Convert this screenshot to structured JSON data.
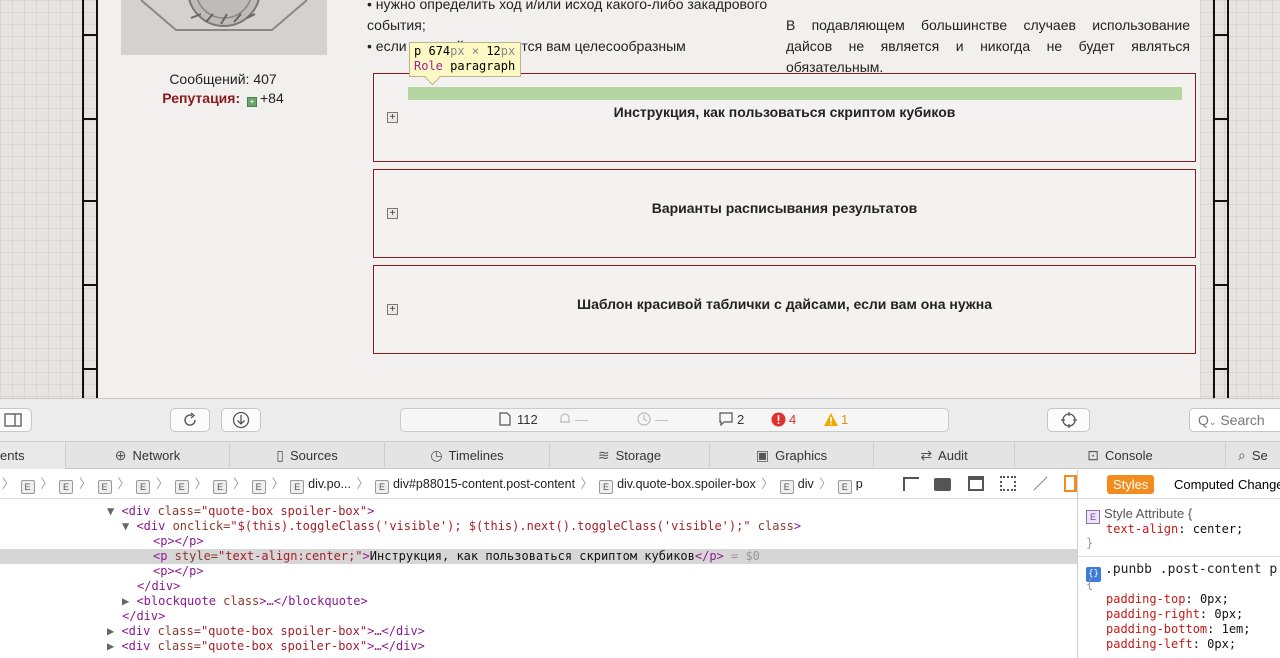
{
  "page": {
    "posts_label": "Сообщений: 407",
    "rep_label": "Репутация:",
    "rep_value": "+84",
    "left_lines": [
      "• нужно определить ход и/или исход какого-либо закадрового",
      "события;",
      "• если"
    ],
    "left_line3_tail": "айсов кажется вам целесообразным",
    "right_text": "В подавляющем большинстве случаев использование дайсов не является и никогда не будет являться обязательным.",
    "spoilers": [
      {
        "title": "Инструкция, как пользоваться скриптом кубиков",
        "toggle": "+"
      },
      {
        "title": "Варианты расписывания результатов",
        "toggle": "+"
      },
      {
        "title": "Шаблон красивой таблички с дайсами, если вам она нужна",
        "toggle": "+"
      }
    ],
    "tooltip": {
      "tag": "p",
      "width": "674",
      "height": "12",
      "unit": "px",
      "times": "×",
      "role_label": "Role",
      "role_value": "paragraph"
    }
  },
  "devtools": {
    "activity": {
      "resources": "112",
      "dash1": "—",
      "dash2": "—",
      "logs": "2",
      "errors": "4",
      "warnings": "1"
    },
    "search_placeholder": "Search",
    "tabs": [
      {
        "label": "ents",
        "icon": ""
      },
      {
        "label": "Network",
        "icon": "network-icon"
      },
      {
        "label": "Sources",
        "icon": "sources-icon"
      },
      {
        "label": "Timelines",
        "icon": "timelines-icon"
      },
      {
        "label": "Storage",
        "icon": "storage-icon"
      },
      {
        "label": "Graphics",
        "icon": "graphics-icon"
      },
      {
        "label": "Audit",
        "icon": "audit-icon"
      },
      {
        "label": "Console",
        "icon": "console-icon"
      },
      {
        "label": "Se",
        "icon": "search-icon"
      }
    ],
    "breadcrumbs": [
      "div.po...",
      "div#p88015-content.post-content",
      "div.quote-box.spoiler-box",
      "div",
      "p"
    ],
    "dom": {
      "l1_tag": "<div",
      "l1_attr": " class=",
      "l1_val": "\"quote-box spoiler-box\"",
      "l1_end": ">",
      "l2_tag": "<div",
      "l2_attr": " onclick=",
      "l2_val": "\"$(this).toggleClass('visible'); $(this).next().toggleClass('visible');\"",
      "l2_attr2": " class",
      "l2_end": ">",
      "l3": "<p></p>",
      "l4_tag": "<p",
      "l4_attr": " style=",
      "l4_val": "\"text-align:center;\"",
      "l4_gt": ">",
      "l4_text": "Инструкция, как пользоваться скриптом кубиков",
      "l4_close": "</p>",
      "l4_ref": " = $0",
      "l5": "<p></p>",
      "l6": "</div>",
      "l7_tag": "<blockquote",
      "l7_attr": " class",
      "l7_rest": ">…</blockquote>",
      "l8": "</div>",
      "l9_tag": "<div",
      "l9_attr": " class=",
      "l9_val": "\"quote-box spoiler-box\"",
      "l9_rest": ">…</div>",
      "l10_tag": "<div",
      "l10_attr": " class=",
      "l10_val": "\"quote-box spoiler-box\"",
      "l10_rest": ">…</div>"
    },
    "sidebar": {
      "tab_styles": "Styles",
      "tab_computed": "Computed",
      "tab_changes": "Change",
      "style_attr_title": "Style Attribute {",
      "style_attr_prop": "text-align",
      "style_attr_val": "center;",
      "close_brace": "}",
      "rule2_selector": ".punbb .post-content p",
      "open_brace": "{",
      "rule2_props": [
        {
          "prop": "padding-top",
          "val": "0px;"
        },
        {
          "prop": "padding-right",
          "val": "0px;"
        },
        {
          "prop": "padding-bottom",
          "val": "1em;"
        },
        {
          "prop": "padding-left",
          "val": "0px;"
        }
      ]
    }
  }
}
